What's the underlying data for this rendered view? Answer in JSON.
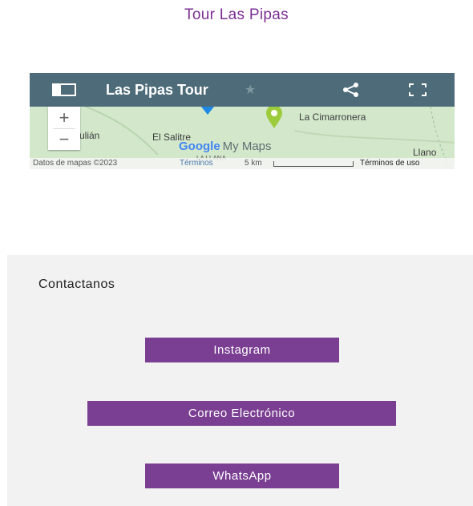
{
  "page": {
    "title": "Tour Las Pipas"
  },
  "map": {
    "title": "Las Pipas Tour",
    "places": {
      "la_cimarronera": "La Cimarronera",
      "julian": "Julián",
      "el_salitre": "El Salitre",
      "llano": "Llano",
      "la_llana": "LA LLANA"
    },
    "logo": {
      "google": "Google",
      "mymaps": "My Maps"
    },
    "footer": {
      "data": "Datos de mapas ©2023",
      "terms": "Términos",
      "scale": "5 km",
      "terms_of_use": "Términos de uso"
    },
    "zoom_in": "+",
    "zoom_out": "−",
    "colors": {
      "header": "#4d6b78",
      "pin": "#9ccc3c"
    }
  },
  "contact": {
    "heading": "Contactanos",
    "buttons": {
      "instagram": "Instagram",
      "email": "Correo Electrónico",
      "whatsapp": "WhatsApp"
    },
    "colors": {
      "button": "#7a3e92",
      "section_bg": "#f2f2f2"
    }
  },
  "icons": [
    "side-panel-icon",
    "star-icon",
    "share-icon",
    "fullscreen-icon",
    "map-pin-icon"
  ]
}
